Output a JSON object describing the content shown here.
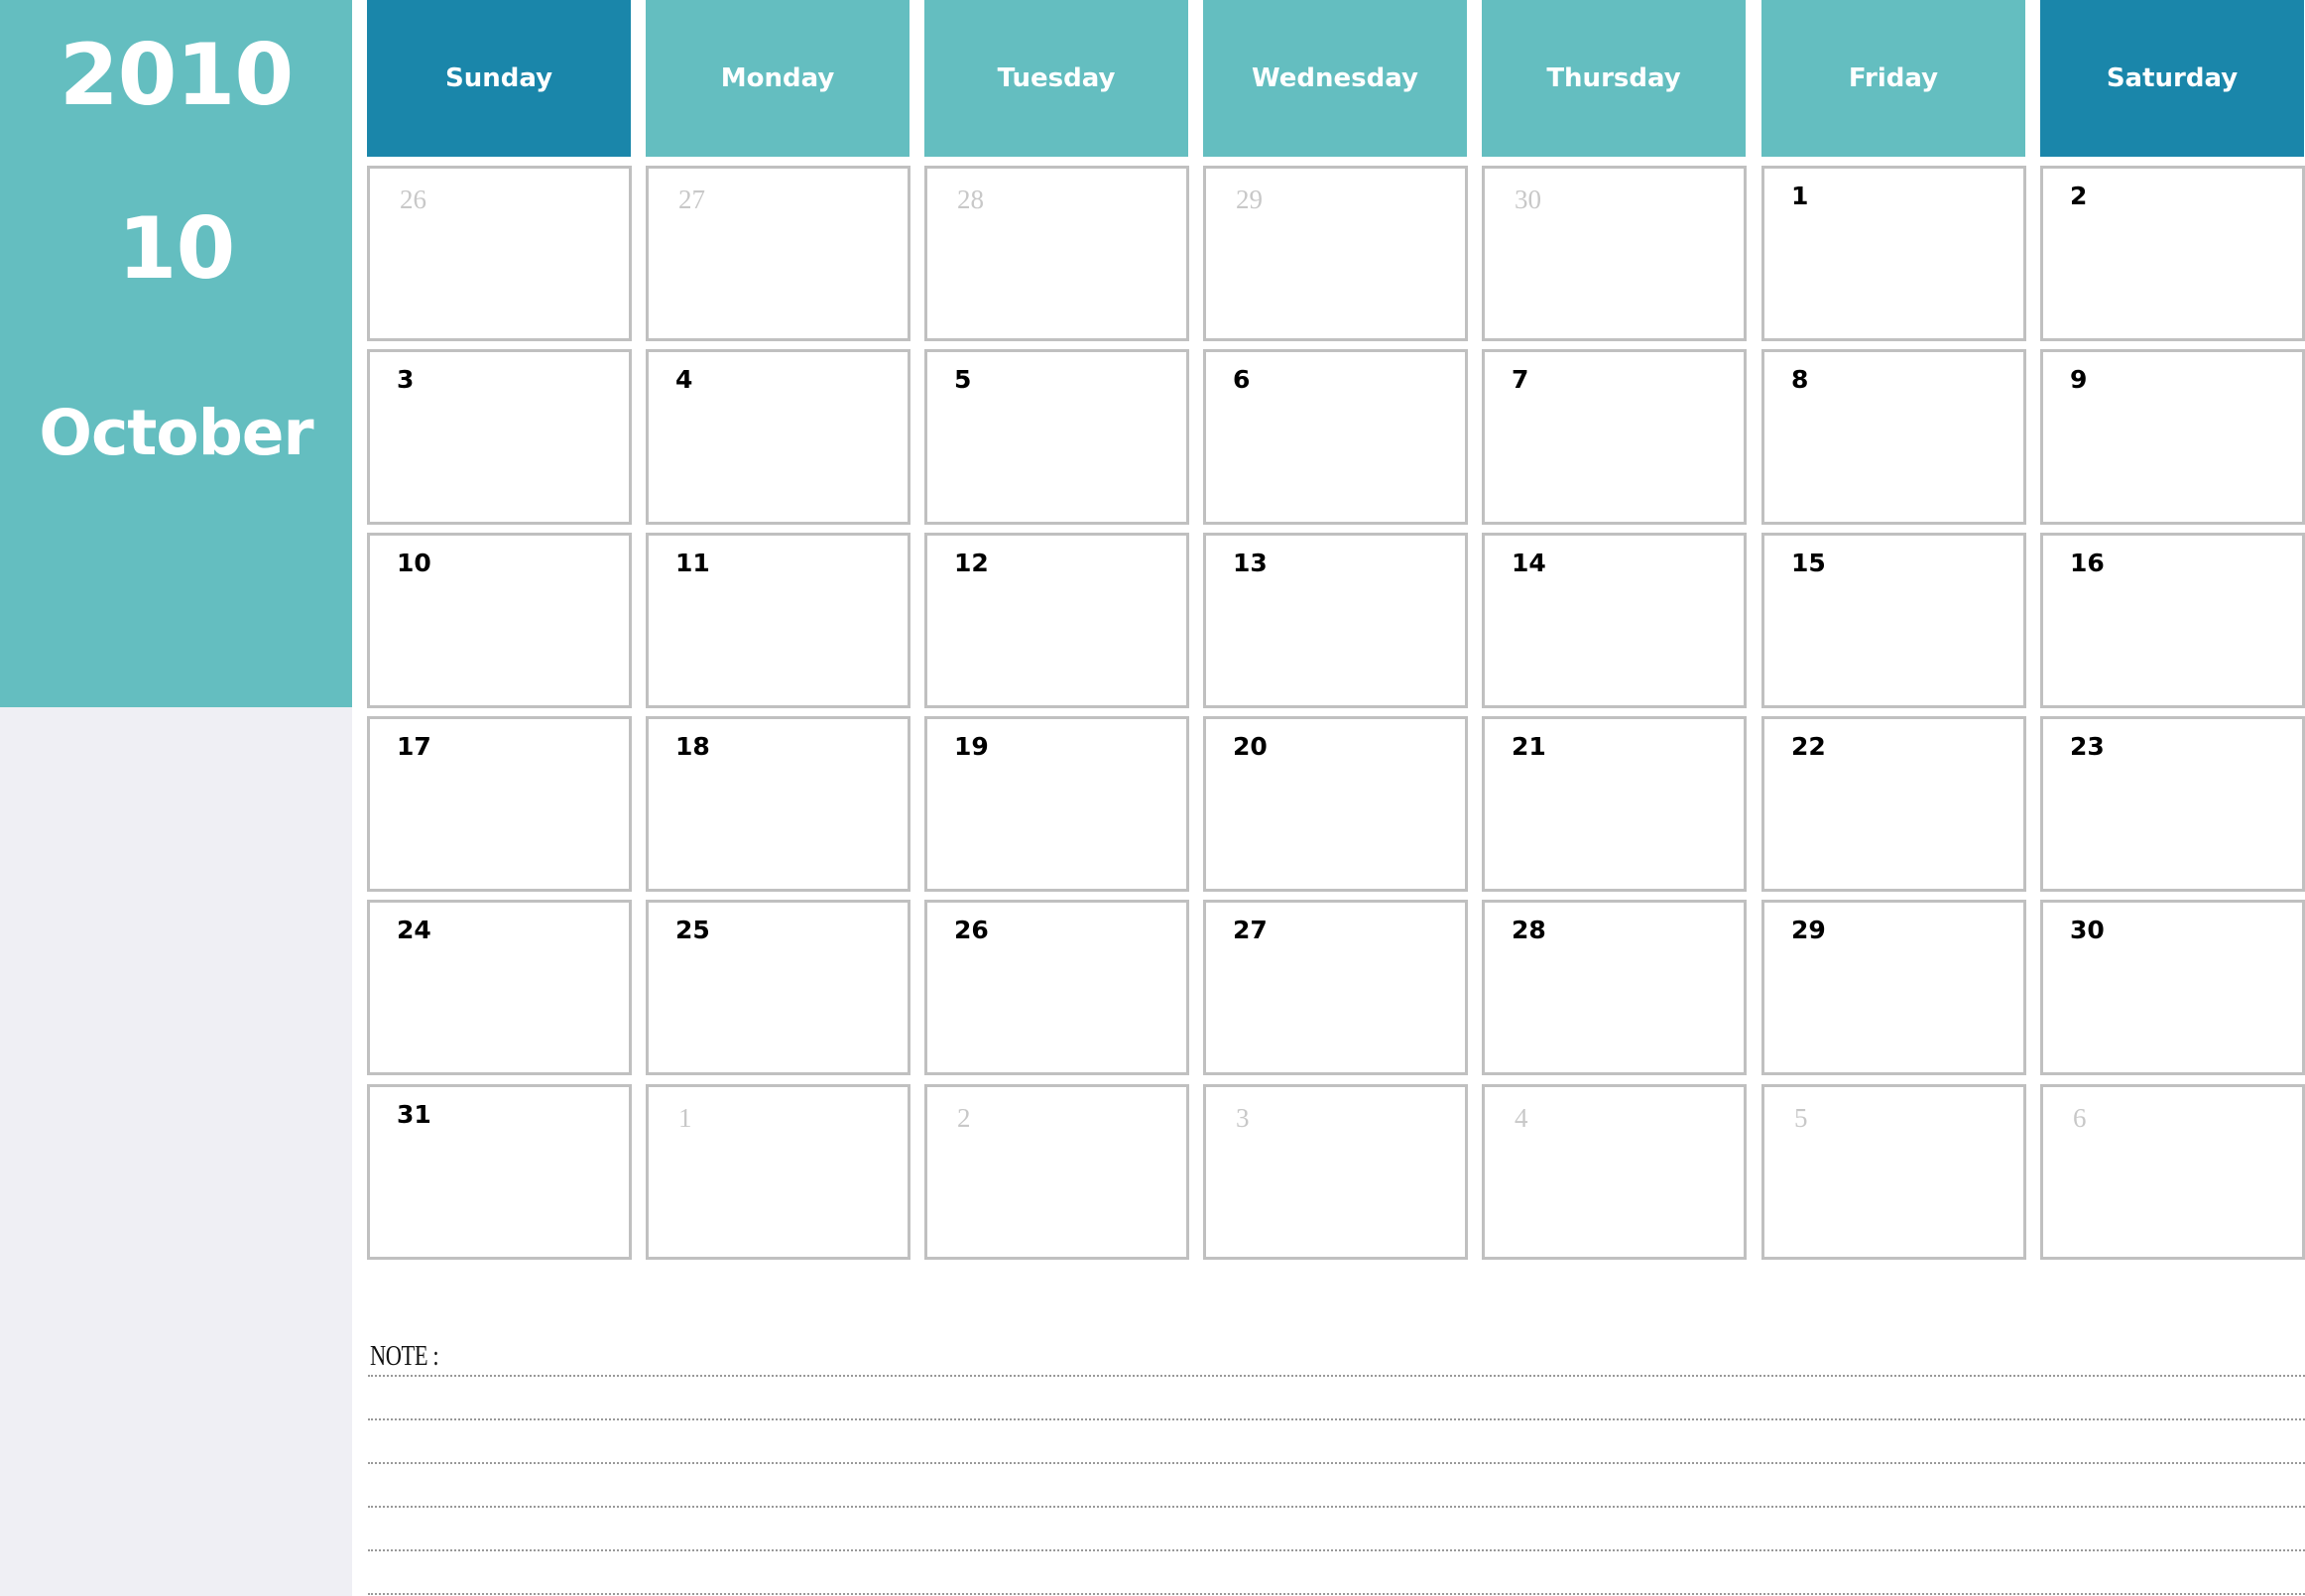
{
  "sidebar": {
    "year": "2010",
    "month_number": "10",
    "month_name": "October"
  },
  "colors": {
    "teal": "#64bec0",
    "weekend_header": "#1a86aa",
    "sidebar_bg": "#efeff4",
    "cell_border": "#c0c0c0",
    "other_month_text": "#c8c8c8"
  },
  "weekdays": [
    {
      "label": "Sunday",
      "weekend": true
    },
    {
      "label": "Monday",
      "weekend": false
    },
    {
      "label": "Tuesday",
      "weekend": false
    },
    {
      "label": "Wednesday",
      "weekend": false
    },
    {
      "label": "Thursday",
      "weekend": false
    },
    {
      "label": "Friday",
      "weekend": false
    },
    {
      "label": "Saturday",
      "weekend": true
    }
  ],
  "weeks": [
    [
      {
        "day": "26",
        "current": false
      },
      {
        "day": "27",
        "current": false
      },
      {
        "day": "28",
        "current": false
      },
      {
        "day": "29",
        "current": false
      },
      {
        "day": "30",
        "current": false
      },
      {
        "day": "1",
        "current": true
      },
      {
        "day": "2",
        "current": true
      }
    ],
    [
      {
        "day": "3",
        "current": true
      },
      {
        "day": "4",
        "current": true
      },
      {
        "day": "5",
        "current": true
      },
      {
        "day": "6",
        "current": true
      },
      {
        "day": "7",
        "current": true
      },
      {
        "day": "8",
        "current": true
      },
      {
        "day": "9",
        "current": true
      }
    ],
    [
      {
        "day": "10",
        "current": true
      },
      {
        "day": "11",
        "current": true
      },
      {
        "day": "12",
        "current": true
      },
      {
        "day": "13",
        "current": true
      },
      {
        "day": "14",
        "current": true
      },
      {
        "day": "15",
        "current": true
      },
      {
        "day": "16",
        "current": true
      }
    ],
    [
      {
        "day": "17",
        "current": true
      },
      {
        "day": "18",
        "current": true
      },
      {
        "day": "19",
        "current": true
      },
      {
        "day": "20",
        "current": true
      },
      {
        "day": "21",
        "current": true
      },
      {
        "day": "22",
        "current": true
      },
      {
        "day": "23",
        "current": true
      }
    ],
    [
      {
        "day": "24",
        "current": true
      },
      {
        "day": "25",
        "current": true
      },
      {
        "day": "26",
        "current": true
      },
      {
        "day": "27",
        "current": true
      },
      {
        "day": "28",
        "current": true
      },
      {
        "day": "29",
        "current": true
      },
      {
        "day": "30",
        "current": true
      }
    ],
    [
      {
        "day": "31",
        "current": true
      },
      {
        "day": "1",
        "current": false
      },
      {
        "day": "2",
        "current": false
      },
      {
        "day": "3",
        "current": false
      },
      {
        "day": "4",
        "current": false
      },
      {
        "day": "5",
        "current": false
      },
      {
        "day": "6",
        "current": false
      }
    ]
  ],
  "notes": {
    "label": "NOTE :",
    "line_count": 6
  }
}
